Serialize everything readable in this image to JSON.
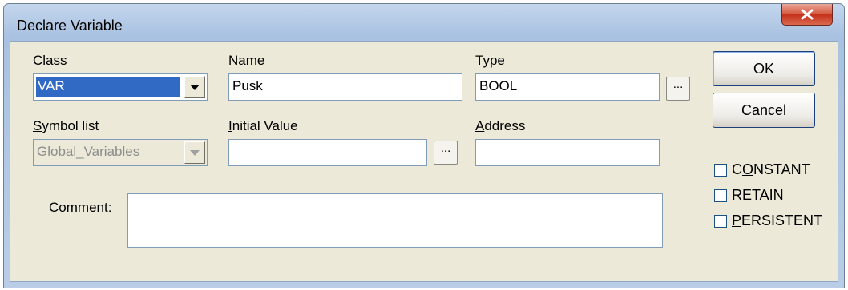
{
  "window": {
    "title": "Declare Variable"
  },
  "fields": {
    "class": {
      "label_u": "C",
      "label_rest": "lass",
      "value": "VAR"
    },
    "name": {
      "label_u": "N",
      "label_rest": "ame",
      "value": "Pusk"
    },
    "type": {
      "label_u": "T",
      "label_rest": "ype",
      "value": "BOOL",
      "browse_label": "..."
    },
    "symbol_list": {
      "label_u": "S",
      "label_rest": "ymbol list",
      "value": "Global_Variables"
    },
    "initial_value": {
      "label_u": "I",
      "label_rest": "nitial Value",
      "value": "",
      "browse_label": "..."
    },
    "address": {
      "label_u": "A",
      "label_rest": "ddress",
      "value": ""
    },
    "comment": {
      "label_pre": "Com",
      "label_u": "m",
      "label_rest": "ent:",
      "value": ""
    }
  },
  "buttons": {
    "ok": "OK",
    "cancel": "Cancel"
  },
  "checkboxes": {
    "constant": {
      "pre": "C",
      "u": "O",
      "rest": "NSTANT",
      "checked": false
    },
    "retain": {
      "pre": "",
      "u": "R",
      "rest": "ETAIN",
      "checked": false
    },
    "persistent": {
      "pre": "",
      "u": "P",
      "rest": "ERSISTENT",
      "checked": false
    }
  }
}
